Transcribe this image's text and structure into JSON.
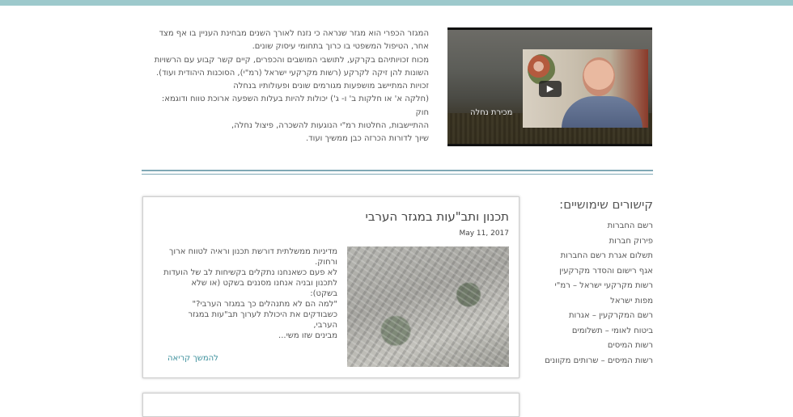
{
  "intro": {
    "lines": [
      "המגזר הכפרי הוא מגזר שנראה כי נזנח לאורך השנים מבחינת העניין בו אף מצד",
      "אחר, הטיפול המשפטי בו כרוך בתחומי עיסוק שונים.",
      "מכוח זכויותיהם בקרקע, לתושבי המושבים והכפרים, קיים קשר קבוע עם הרשויות",
      "השונות להן זיקה לקרקע (רשות מקרקעי ישראל (רמ\"י), הסוכנות היהודית ועוד).",
      "זכויות המתיישב מושפעות מגורמים שונים ופעולותיו בנחלה",
      "(חלקה א' או חלקות ב' ו- ג') יכולות להיות בעלות השפעה ארוכת טווח ודוגמא: חוק",
      "ההתיישבות, החלטות רמ\"י הנוגעות להשכרה, פיצול נחלה,",
      "שיוך לדורות הכרזה כבן ממשיך ועוד."
    ]
  },
  "video": {
    "caption": "מכירת נחלה",
    "play_symbol": "▶"
  },
  "useful_links": {
    "title": "קישורים שימושיים:",
    "items": [
      "רשם החברות",
      "פירוק חברות",
      "תשלום אגרת רשם החברות",
      "אגף רישום והסדר מקרקעין",
      "רשות מקרקעי ישראל – רמ\"י",
      "מפות ישראל",
      "רשם המקרקעין – אגרות",
      "ביטוח לאומי – תשלומים",
      "רשות המיסים",
      "רשות המיסים – שרותים מקוונים"
    ]
  },
  "post": {
    "title": "תכנון ותב\"עות במגזר הערבי",
    "date": "May 11, 2017",
    "excerpt_lines": [
      "מדיניות ממשלתית דורשת תכנון וראיה לטווח ארוך",
      "ורחוק.",
      "לא פעם כשאנחנו נתקלים בקשיחות לב של הועדות",
      "לתכנון ובניה אנחנו מסננים בשקט (או שלא בשקט):",
      "\"למה הם לא מתנהלים כך במגזר הערבי?\"",
      "כשבודקים את היכולת לערוך תב\"עות במגזר הערבי,",
      "מבינים שזו משי..."
    ],
    "read_more": "להמשך קריאה"
  }
}
